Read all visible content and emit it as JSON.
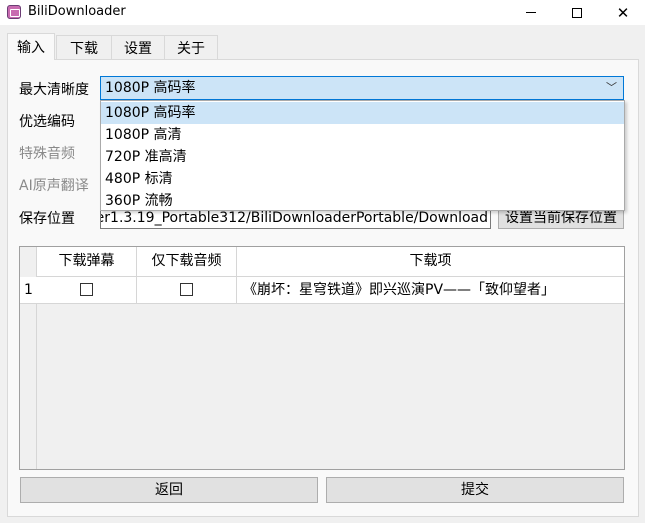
{
  "window": {
    "title": "BiliDownloader",
    "minimize_glyph": "",
    "maximize_glyph": "",
    "close_glyph": "✕"
  },
  "tabs": [
    {
      "label": "输入",
      "active": true
    },
    {
      "label": "下载",
      "active": false
    },
    {
      "label": "设置",
      "active": false
    },
    {
      "label": "关于",
      "active": false
    }
  ],
  "form": {
    "max_quality_label": "最大清晰度",
    "max_quality_value": "1080P 高码率",
    "codec_label": "优选编码",
    "special_audio_label": "特殊音频",
    "ai_translate_label": "AI原声翻译",
    "save_location_label": "保存位置",
    "save_location_value": "er1.3.19_Portable312/BiliDownloaderPortable/Download",
    "set_current_button": "设置当前保存位置"
  },
  "quality_options": [
    {
      "label": "1080P 高码率",
      "selected": true
    },
    {
      "label": "1080P 高清",
      "selected": false
    },
    {
      "label": "720P 准高清",
      "selected": false
    },
    {
      "label": "480P 标清",
      "selected": false
    },
    {
      "label": "360P 流畅",
      "selected": false
    }
  ],
  "table": {
    "headers": [
      "下载弹幕",
      "仅下载音频",
      "下载项"
    ],
    "rows": [
      {
        "index": "1",
        "danmaku": false,
        "audio_only": false,
        "item": "《崩坏：星穹铁道》即兴巡演PV——「致仰望者」"
      }
    ]
  },
  "buttons": {
    "back": "返回",
    "submit": "提交"
  },
  "icons": {
    "chevron": "﹀"
  }
}
